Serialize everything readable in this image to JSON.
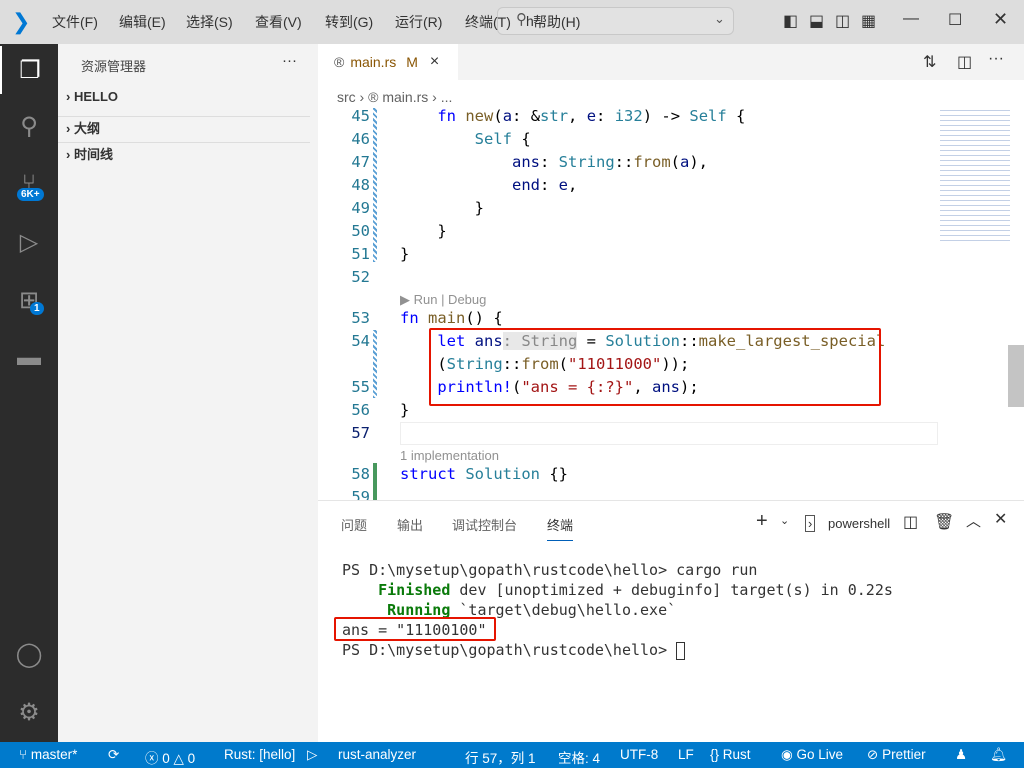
{
  "titlebar": {
    "menus": [
      "文件(F)",
      "编辑(E)",
      "选择(S)",
      "查看(V)",
      "转到(G)",
      "运行(R)",
      "终端(T)",
      "帮助(H)"
    ],
    "search_text": "h"
  },
  "activity": {
    "scm_badge": "6K+",
    "extensions_badge": "1"
  },
  "sidebar": {
    "title": "资源管理器",
    "more": "···",
    "sections": [
      "HELLO",
      "大纲",
      "时间线"
    ]
  },
  "editor": {
    "tab": {
      "name": "main.rs",
      "status": "M",
      "close": "×"
    },
    "breadcrumb": [
      "src",
      "main.rs",
      "..."
    ],
    "line_numbers": [
      "45",
      "46",
      "47",
      "48",
      "49",
      "50",
      "51",
      "52",
      "53",
      "54",
      "",
      "55",
      "56",
      "57",
      "58",
      "59"
    ],
    "codelens": [
      "▶ Run | Debug",
      "1 implementation"
    ]
  },
  "panel": {
    "tabs": [
      "问题",
      "输出",
      "调试控制台",
      "终端"
    ],
    "active_tab": "终端",
    "shell": "powershell",
    "terminal": [
      "PS D:\\mysetup\\gopath\\rustcode\\hello> cargo run",
      "    Finished dev [unoptimized + debuginfo] target(s) in 0.22s",
      "     Running `target\\debug\\hello.exe`",
      "ans = \"11100100\"",
      "PS D:\\mysetup\\gopath\\rustcode\\hello> "
    ]
  },
  "status": {
    "branch": "master*",
    "errors": "0",
    "warnings": "0",
    "rust": "Rust: [hello]",
    "analyzer": "rust-analyzer",
    "position": "行 57，列 1",
    "spaces": "空格: 4",
    "encoding": "UTF-8",
    "eol": "LF",
    "language": "Rust",
    "golive": "Go Live",
    "prettier": "Prettier"
  },
  "colors": {
    "accent": "#007acc",
    "highlight": "#e51400"
  }
}
